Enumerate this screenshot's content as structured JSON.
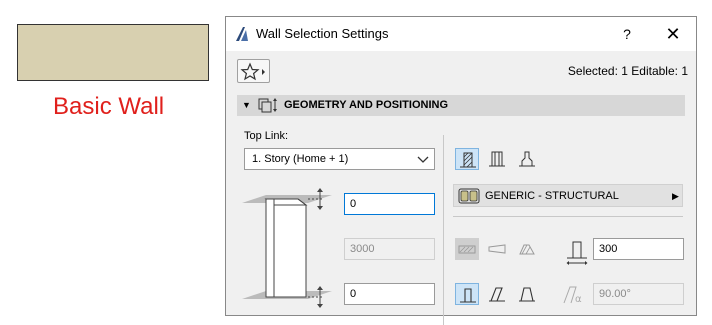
{
  "canvas": {
    "element_label": "Basic Wall",
    "label_color": "#e0201c",
    "swatch_color": "#d8d0b0"
  },
  "dialog": {
    "title": "Wall Selection Settings",
    "help_label": "?",
    "close_label": "✕",
    "selected_info": "Selected: 1 Editable: 1",
    "favorites_icon": "star-icon",
    "section": {
      "title": "GEOMETRY AND POSITIONING",
      "expanded": true
    },
    "top_link": {
      "label": "Top Link:",
      "value": "1. Story (Home + 1)"
    },
    "top_offset": "0",
    "wall_height": "3000",
    "bottom_offset": "0",
    "structure_buttons": [
      "basic-structure-icon",
      "composite-structure-icon",
      "profile-structure-icon"
    ],
    "composite": {
      "label": "GENERIC - STRUCTURAL"
    },
    "shape_buttons": [
      "straight-wall-icon",
      "trapezoid-wall-icon",
      "polygonal-wall-icon"
    ],
    "thickness": "300",
    "slant_buttons": [
      "vertical-wall-icon",
      "slanted-wall-icon",
      "double-slanted-wall-icon"
    ],
    "slant_angle": "90.00°",
    "accent_color": "#0078d7"
  }
}
